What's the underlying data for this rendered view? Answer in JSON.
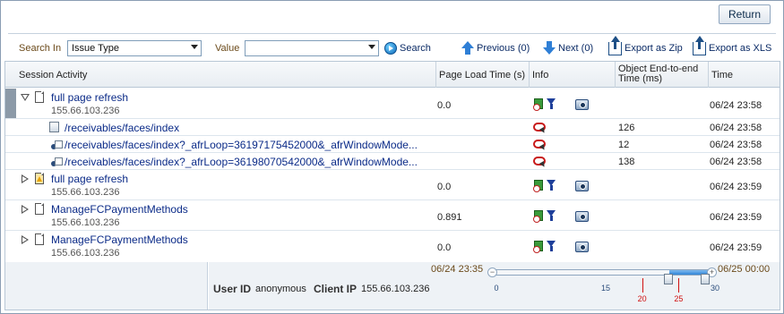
{
  "top": {
    "return_label": "Return"
  },
  "toolbar": {
    "search_in_label": "Search In",
    "search_in_value": "Issue Type",
    "value_label": "Value",
    "value_value": "",
    "search_label": "Search",
    "previous_label": "Previous (0)",
    "next_label": "Next (0)",
    "export_zip_label": "Export as Zip",
    "export_xls_label": "Export as XLS"
  },
  "table": {
    "columns": [
      "Session Activity",
      "Page Load Time (s)",
      "Info",
      "Object End-to-end Time (ms)",
      "Time"
    ],
    "rows": [
      {
        "kind": "page",
        "expanded": true,
        "title": "full page refresh",
        "ip": "155.66.103.236",
        "load": "0.0",
        "e2e": "",
        "time": "06/24 23:58"
      },
      {
        "kind": "request",
        "title": "/receivables/faces/index",
        "load": "",
        "e2e": "126",
        "time": "06/24 23:58"
      },
      {
        "kind": "request",
        "title": "/receivables/faces/index?_afrLoop=36197175452000&_afrWindowMode...",
        "load": "",
        "e2e": "12",
        "time": "06/24 23:58"
      },
      {
        "kind": "request",
        "title": "/receivables/faces/index?_afrLoop=36198070542000&_afrWindowMode...",
        "load": "",
        "e2e": "138",
        "time": "06/24 23:58"
      },
      {
        "kind": "page-warn",
        "expanded": false,
        "title": "full page refresh",
        "ip": "155.66.103.236",
        "load": "0.0",
        "e2e": "",
        "time": "06/24 23:59"
      },
      {
        "kind": "page",
        "expanded": false,
        "title": "ManageFCPaymentMethods",
        "ip": "155.66.103.236",
        "load": "0.891",
        "e2e": "",
        "time": "06/24 23:59"
      },
      {
        "kind": "page",
        "expanded": false,
        "title": "ManageFCPaymentMethods",
        "ip": "155.66.103.236",
        "load": "0.0",
        "e2e": "",
        "time": "06/24 23:59"
      }
    ]
  },
  "footer": {
    "user_id_label": "User ID",
    "user_id_value": "anonymous",
    "client_ip_label": "Client IP",
    "client_ip_value": "155.66.103.236",
    "range_start": "06/24 23:35",
    "range_end": "06/25 00:00",
    "ticks": [
      "0",
      "15",
      "30"
    ],
    "markers": [
      "20",
      "25"
    ],
    "selection_start_fraction": 0.8,
    "selection_end_fraction": 1.0
  },
  "colors": {
    "link": "#0b2b88",
    "accent": "#2f84d6",
    "marker": "#d01010"
  }
}
